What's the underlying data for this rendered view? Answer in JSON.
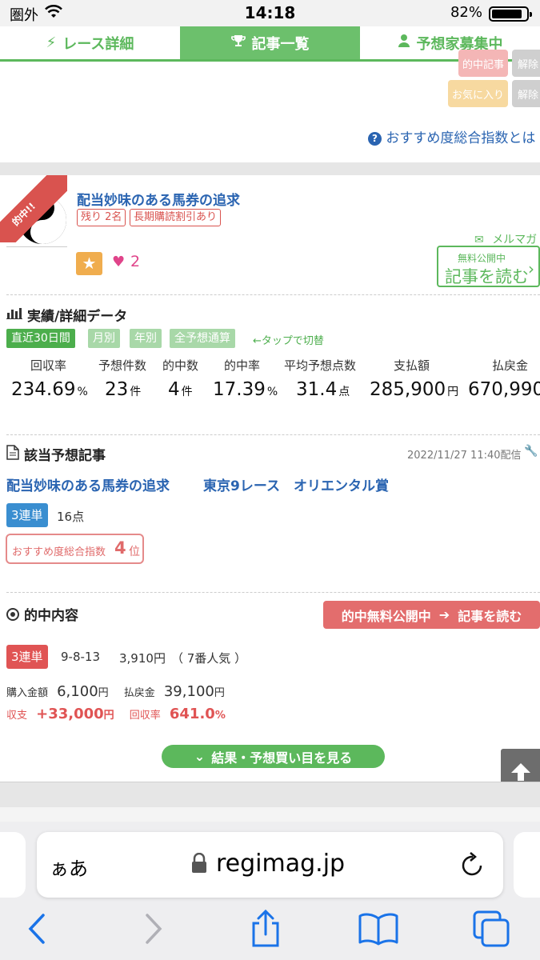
{
  "status": {
    "carrier": "圏外",
    "time": "14:18",
    "battery": "82%"
  },
  "tabs": [
    {
      "label": "レース詳細"
    },
    {
      "label": "記事一覧"
    },
    {
      "label": "予想家募集中"
    }
  ],
  "top_buttons": {
    "favorite": "お気に入り",
    "release": "解除",
    "partial_1": "的中記事",
    "partial_2": "解除"
  },
  "help_link": "おすすめ度総合指数とは",
  "article": {
    "hit_badge": "的中!!",
    "title": "配当妙味のある馬券の追求",
    "tag_remaining": "残り 2名",
    "tag_discount": "長期購読割引あり",
    "mailmag": "メルマガ",
    "likes": "2",
    "read_btn_small": "無料公開中",
    "read_btn_main": "記事を読む"
  },
  "stats_section": {
    "title": "実績/詳細データ",
    "periods": [
      "直近30日間",
      "月別",
      "年別",
      "全予想通算"
    ],
    "tap_hint": "←タップで切替",
    "headers": [
      "回収率",
      "予想件数",
      "的中数",
      "的中率",
      "平均予想点数",
      "支払額",
      "払戻金"
    ],
    "values": [
      {
        "v": "234.69",
        "u": "%"
      },
      {
        "v": "23",
        "u": "件"
      },
      {
        "v": "4",
        "u": "件"
      },
      {
        "v": "17.39",
        "u": "%"
      },
      {
        "v": "31.4",
        "u": "点"
      },
      {
        "v": "285,900",
        "u": "円"
      },
      {
        "v": "670,990",
        "u": ""
      }
    ]
  },
  "prediction": {
    "section_title": "該当予想記事",
    "date": "2022/11/27 11:40配信",
    "title": "配当妙味のある馬券の追求",
    "race": "東京9レース　オリエンタル賞",
    "bet_type": "3連単",
    "points": "16点",
    "rank_label": "おすすめ度総合指数",
    "rank_value": "4",
    "rank_unit": "位"
  },
  "hit": {
    "section_title": "的中内容",
    "cta": "的中無料公開中",
    "cta_read": "記事を読む",
    "bet_type": "3連単",
    "combo": "9-8-13",
    "payout": "3,910円",
    "popularity": "（ 7番人気 ）",
    "purchase_label": "購入金額",
    "purchase": "6,100",
    "refund_label": "払戻金",
    "refund": "39,100",
    "yen": "円",
    "balance_label": "収支",
    "balance": "+33,000",
    "rate_label": "回収率",
    "rate": "641.0",
    "pct": "%",
    "results_btn": "結果・予想買い目を見る"
  },
  "browser": {
    "aa": "ぁあ",
    "url": "regimag.jp"
  }
}
